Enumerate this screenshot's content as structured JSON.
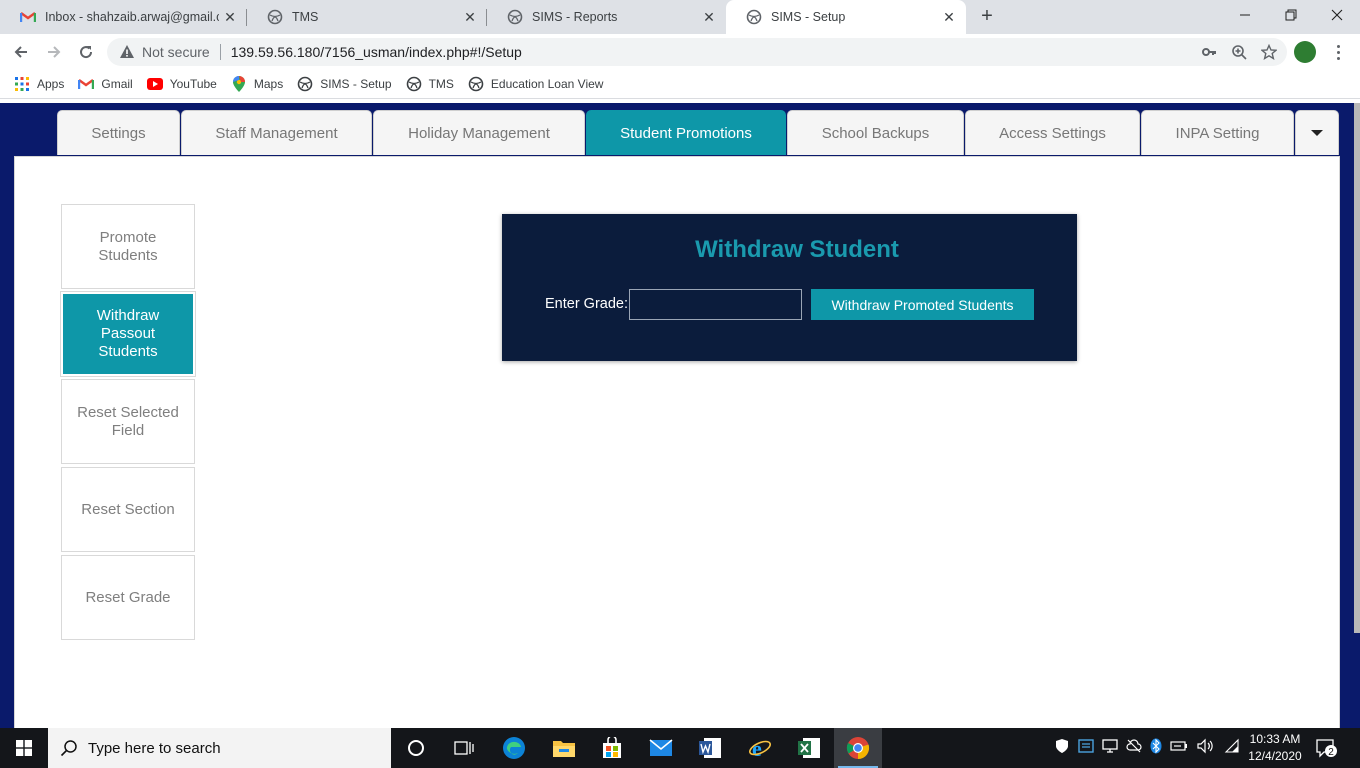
{
  "browser": {
    "tabs": [
      {
        "title": "Inbox - shahzaib.arwaj@gmail.co",
        "icon": "gmail-icon",
        "active": false
      },
      {
        "title": "TMS",
        "icon": "globe-icon",
        "active": false
      },
      {
        "title": "SIMS - Reports",
        "icon": "globe-icon",
        "active": false
      },
      {
        "title": "SIMS - Setup",
        "icon": "globe-icon",
        "active": true
      }
    ],
    "close_glyph": "✕",
    "new_tab_glyph": "+",
    "security_label": "Not secure",
    "url": "139.59.56.180/7156_usman/index.php#!/Setup",
    "bookmarks": [
      {
        "label": "Apps",
        "icon": "apps-grid-icon"
      },
      {
        "label": "Gmail",
        "icon": "gmail-icon"
      },
      {
        "label": "YouTube",
        "icon": "youtube-icon"
      },
      {
        "label": "Maps",
        "icon": "maps-icon"
      },
      {
        "label": "SIMS - Setup",
        "icon": "globe-icon"
      },
      {
        "label": "TMS",
        "icon": "globe-icon"
      },
      {
        "label": "Education Loan View",
        "icon": "globe-icon"
      }
    ]
  },
  "app": {
    "nav_tabs": [
      {
        "label": "Settings",
        "active": false
      },
      {
        "label": "Staff Management",
        "active": false
      },
      {
        "label": "Holiday Management",
        "active": false
      },
      {
        "label": "Student Promotions",
        "active": true
      },
      {
        "label": "School Backups",
        "active": false
      },
      {
        "label": "Access Settings",
        "active": false
      },
      {
        "label": "INPA Setting",
        "active": false
      }
    ],
    "sidebar": [
      {
        "label": "Promote Students",
        "active": false
      },
      {
        "label": "Withdraw Passout Students",
        "active": true
      },
      {
        "label": "Reset Selected Field",
        "active": false
      },
      {
        "label": "Reset Section",
        "active": false
      },
      {
        "label": "Reset Grade",
        "active": false
      }
    ],
    "form": {
      "title": "Withdraw Student",
      "grade_label": "Enter Grade:",
      "grade_value": "",
      "grade_placeholder": "",
      "submit_label": "Withdraw Promoted Students"
    },
    "colors": {
      "accent": "#0e97a8",
      "nav_background": "#0a1a6b",
      "card_background": "#0b1c3c"
    }
  },
  "taskbar": {
    "search_placeholder": "Type here to search",
    "apps": [
      "cortana-icon",
      "task-view-icon",
      "edge-icon",
      "file-explorer-icon",
      "store-icon",
      "mail-icon",
      "word-icon",
      "internet-explorer-icon",
      "excel-icon",
      "chrome-icon"
    ],
    "time": "10:33 AM",
    "date": "12/4/2020",
    "notification_count": "2"
  }
}
